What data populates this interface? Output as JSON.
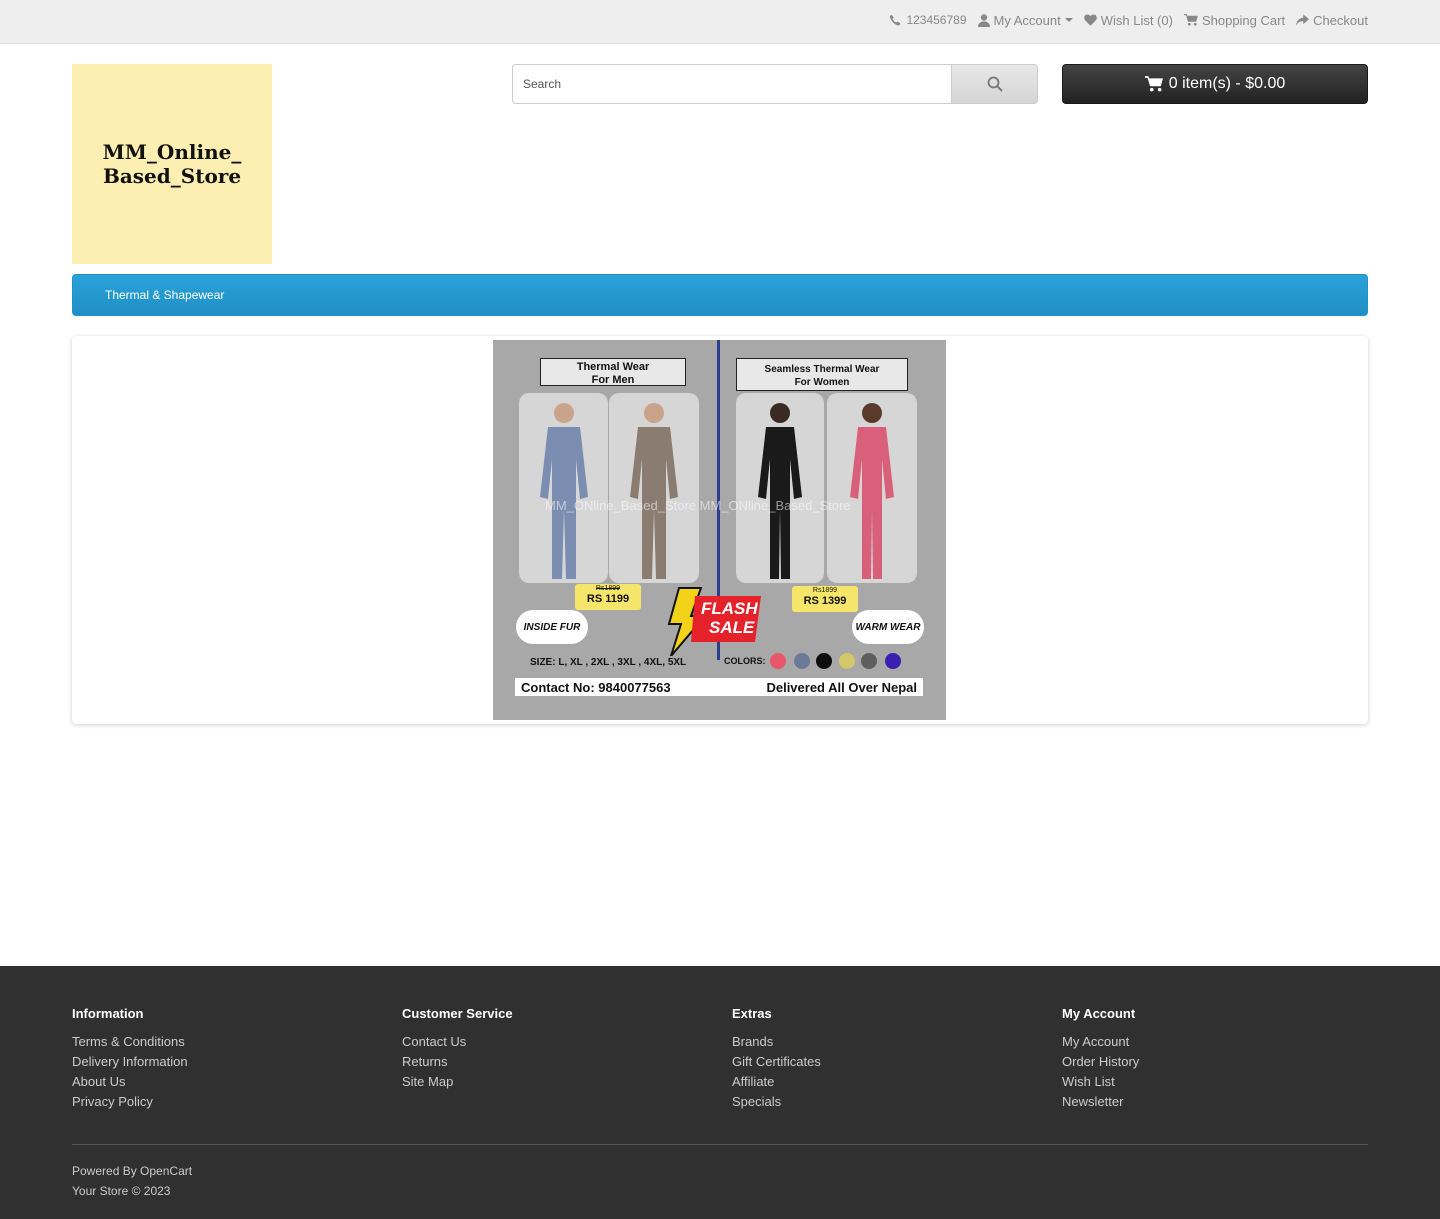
{
  "topbar": {
    "phone": "123456789",
    "my_account": "My Account",
    "wish_list": "Wish List (0)",
    "shopping_cart": "Shopping Cart",
    "checkout": "Checkout"
  },
  "logo": {
    "line1": "MM_Online_",
    "line2": "Based_Store",
    "bg_color": "#fdeeb2"
  },
  "search": {
    "placeholder": "Search",
    "value": ""
  },
  "cart": {
    "label": "0 item(s) - $0.00"
  },
  "menu": {
    "items": [
      {
        "label": "Thermal & Shapewear"
      }
    ],
    "color": "#229ac8"
  },
  "banner": {
    "left_title_1": "Thermal Wear",
    "left_title_2": "For Men",
    "right_title_1": "Seamless Thermal Wear",
    "right_title_2": "For Women",
    "watermark": "MM_ONline_Based_Store  MM_ONline_Based_Store",
    "men_old_price": "Rs1899",
    "men_price": "RS 1199",
    "women_old_price": "Rs1899",
    "women_price": "RS 1399",
    "left_cloud": "INSIDE FUR",
    "right_cloud": "WARM WEAR",
    "flash_1": "FLASH",
    "flash_2": "SALE",
    "sizes": "SIZE: L, XL , 2XL , 3XL , 4XL, 5XL",
    "colors_label": "COLORS:",
    "swatches": [
      "#e8566b",
      "#6c7a9a",
      "#0d0d0d",
      "#d4c76a",
      "#5e5e5e",
      "#3a1fb0"
    ],
    "contact": "Contact No: 9840077563",
    "delivery": "Delivered All Over Nepal"
  },
  "footer": {
    "columns": [
      {
        "title": "Information",
        "links": [
          "Terms & Conditions",
          "Delivery Information",
          "About Us",
          "Privacy Policy"
        ]
      },
      {
        "title": "Customer Service",
        "links": [
          "Contact Us",
          "Returns",
          "Site Map"
        ]
      },
      {
        "title": "Extras",
        "links": [
          "Brands",
          "Gift Certificates",
          "Affiliate",
          "Specials"
        ]
      },
      {
        "title": "My Account",
        "links": [
          "My Account",
          "Order History",
          "Wish List",
          "Newsletter"
        ]
      }
    ],
    "powered_prefix": "Powered By",
    "powered_link": "OpenCart",
    "copyright": "Your Store © 2023"
  }
}
